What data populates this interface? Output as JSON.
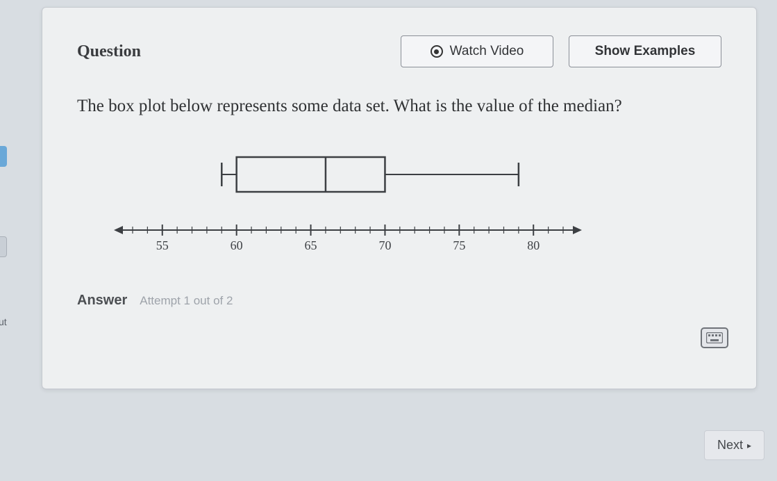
{
  "sidebar": {
    "cut_label": "ut"
  },
  "header": {
    "question_label": "Question",
    "watch_label": "Watch Video",
    "examples_label": "Show Examples"
  },
  "prompt_text": "The box plot below represents some data set. What is the value of the median?",
  "chart_data": {
    "type": "boxplot",
    "axis": {
      "min": 53,
      "max": 82,
      "ticks": [
        55,
        60,
        65,
        70,
        75,
        80
      ]
    },
    "min": 59,
    "q1": 60,
    "median": 66,
    "q3": 70,
    "max": 79,
    "xlabel": "",
    "ylabel": ""
  },
  "answer": {
    "label": "Answer",
    "attempt_text": "Attempt 1 out of 2"
  },
  "footer": {
    "next_label": "Next"
  }
}
